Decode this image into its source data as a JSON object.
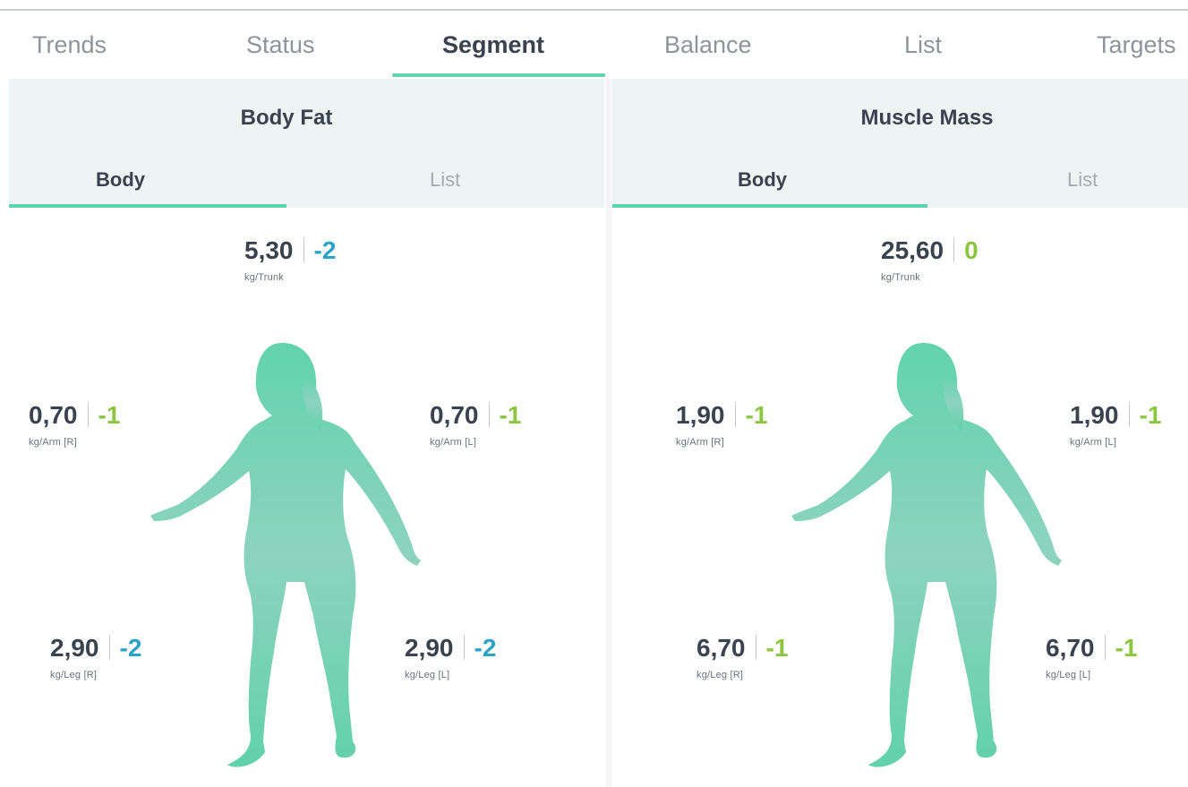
{
  "tabs": [
    {
      "label": "Trends"
    },
    {
      "label": "Status"
    },
    {
      "label": "Segment"
    },
    {
      "label": "Balance"
    },
    {
      "label": "List"
    },
    {
      "label": "Targets"
    }
  ],
  "colors": {
    "accent": "#5fd3ae",
    "delta_blue": "#2ba3c9",
    "delta_green": "#8cc63f",
    "panel_header_bg": "#eef3f4"
  },
  "panels": [
    {
      "title": "Body Fat",
      "subtabs": [
        "Body",
        "List"
      ],
      "metrics": {
        "trunk": {
          "value": "5,30",
          "delta": "-2",
          "unit": "kg/Trunk"
        },
        "arm_r": {
          "value": "0,70",
          "delta": "-1",
          "unit": "kg/Arm [R]"
        },
        "arm_l": {
          "value": "0,70",
          "delta": "-1",
          "unit": "kg/Arm [L]"
        },
        "leg_r": {
          "value": "2,90",
          "delta": "-2",
          "unit": "kg/Leg [R]"
        },
        "leg_l": {
          "value": "2,90",
          "delta": "-2",
          "unit": "kg/Leg [L]"
        }
      }
    },
    {
      "title": "Muscle Mass",
      "subtabs": [
        "Body",
        "List"
      ],
      "metrics": {
        "trunk": {
          "value": "25,60",
          "delta": "0",
          "unit": "kg/Trunk"
        },
        "arm_r": {
          "value": "1,90",
          "delta": "-1",
          "unit": "kg/Arm [R]"
        },
        "arm_l": {
          "value": "1,90",
          "delta": "-1",
          "unit": "kg/Arm [L]"
        },
        "leg_r": {
          "value": "6,70",
          "delta": "-1",
          "unit": "kg/Leg [R]"
        },
        "leg_l": {
          "value": "6,70",
          "delta": "-1",
          "unit": "kg/Leg [L]"
        }
      }
    }
  ],
  "icons": {
    "body_figure": "female-body-silhouette-icon"
  }
}
